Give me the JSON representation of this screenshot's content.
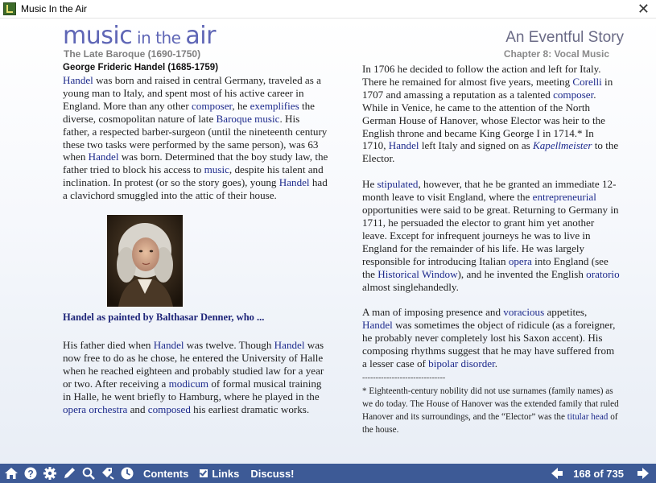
{
  "window": {
    "title": "Music In the Air"
  },
  "brand": {
    "word1": "music",
    "word2": " in the ",
    "word3": "air"
  },
  "header": {
    "era": "The Late Baroque (1690-1750)",
    "story_title": "An Eventful Story",
    "chapter": "Chapter 8: Vocal Music"
  },
  "left": {
    "heading": "George Frideric Handel (1685-1759)",
    "p1": [
      {
        "t": "Handel",
        "link": true
      },
      {
        "t": " was born and raised in central Germany, traveled as a young man to Italy, and spent most of his active career in England. More than any other "
      },
      {
        "t": "composer",
        "link": true
      },
      {
        "t": ", he "
      },
      {
        "t": "exemplifies",
        "link": true
      },
      {
        "t": " the diverse, cosmopolitan nature of late "
      },
      {
        "t": "Baroque music",
        "link": true
      },
      {
        "t": ". His father, a respected barber-surgeon (until the nineteenth century these two tasks were performed by the same person), was 63 when "
      },
      {
        "t": "Handel",
        "link": true
      },
      {
        "t": " was born. Determined that the boy study law, the father tried to block his access to "
      },
      {
        "t": "music",
        "link": true
      },
      {
        "t": ", despite his talent and inclination. In protest (or so the story goes), young "
      },
      {
        "t": "Handel",
        "link": true
      },
      {
        "t": " had a clavichord smuggled into the attic of their house."
      }
    ],
    "caption": "Handel as painted by Balthasar Denner, who ...",
    "p2": [
      {
        "t": "His father died when "
      },
      {
        "t": "Handel",
        "link": true
      },
      {
        "t": " was twelve. Though "
      },
      {
        "t": "Handel",
        "link": true
      },
      {
        "t": " was now free to do as he chose, he entered the University of Halle when he reached eighteen and probably studied law for a year or two. After receiving a "
      },
      {
        "t": "modicum",
        "link": true
      },
      {
        "t": " of formal musical training in Halle, he went briefly to Hamburg, where he played in the "
      },
      {
        "t": "opera orchestra",
        "link": true
      },
      {
        "t": " and "
      },
      {
        "t": "composed",
        "link": true
      },
      {
        "t": " his earliest dramatic works."
      }
    ]
  },
  "right": {
    "p1": [
      {
        "t": "In 1706 he decided to follow the action and left for Italy. There he remained for almost five years, meeting "
      },
      {
        "t": "Corelli",
        "link": true
      },
      {
        "t": " in 1707 and amassing a reputation as a talented "
      },
      {
        "t": "composer",
        "link": true
      },
      {
        "t": ". While in Venice, he came to the attention of the North German House of Hanover, whose Elector was heir to the English throne and became King George I in 1714.* In 1710, "
      },
      {
        "t": "Handel",
        "link": true
      },
      {
        "t": " left Italy and signed on as "
      },
      {
        "t": "Kapellmeister",
        "link": true,
        "italic": true
      },
      {
        "t": " to the Elector."
      }
    ],
    "p2": [
      {
        "t": "He "
      },
      {
        "t": "stipulated",
        "link": true
      },
      {
        "t": ", however, that he be granted an immediate 12-month leave to visit England, where the "
      },
      {
        "t": "entrepreneurial",
        "link": true
      },
      {
        "t": " opportunities were said to be great. Returning to Germany in 1711, he persuaded the elector to grant him yet another leave. Except for infrequent journeys he was to live in England for the remainder of his life. He was largely responsible for introducing Italian "
      },
      {
        "t": "opera",
        "link": true
      },
      {
        "t": " into England (see the "
      },
      {
        "t": "Historical Window",
        "link": true
      },
      {
        "t": "), and he invented the English "
      },
      {
        "t": "oratorio",
        "link": true
      },
      {
        "t": " almost singlehandedly."
      }
    ],
    "p3": [
      {
        "t": "A man of imposing presence and "
      },
      {
        "t": "voracious",
        "link": true
      },
      {
        "t": " appetites, "
      },
      {
        "t": "Handel",
        "link": true
      },
      {
        "t": " was sometimes the object of ridicule (as a foreigner, he probably never completely lost his Saxon accent). His composing rhythms suggest that he may have suffered from a lesser case of "
      },
      {
        "t": "bipolar disorder",
        "link": true
      },
      {
        "t": "."
      }
    ],
    "rule": "-------------------------------",
    "footnote": [
      {
        "t": "* Eighteenth-century nobility did not use surnames (family names) as we do today. The House of Hanover was the extended family that ruled Hanover and its surroundings, and the “Elector” was the "
      },
      {
        "t": "titular head",
        "link": true
      },
      {
        "t": " of the house."
      }
    ]
  },
  "toolbar": {
    "contents": "Contents",
    "links": "Links",
    "discuss": "Discuss!",
    "page_counter": "168 of 735",
    "icons": [
      "home-icon",
      "help-icon",
      "settings-icon",
      "pencil-icon",
      "search-icon",
      "bookmark-icon",
      "history-icon",
      "prev-arrow-icon",
      "next-arrow-icon"
    ]
  },
  "colors": {
    "link": "#1d2a8c",
    "toolbar": "#3d5a96",
    "brand": "#5f66b6"
  }
}
